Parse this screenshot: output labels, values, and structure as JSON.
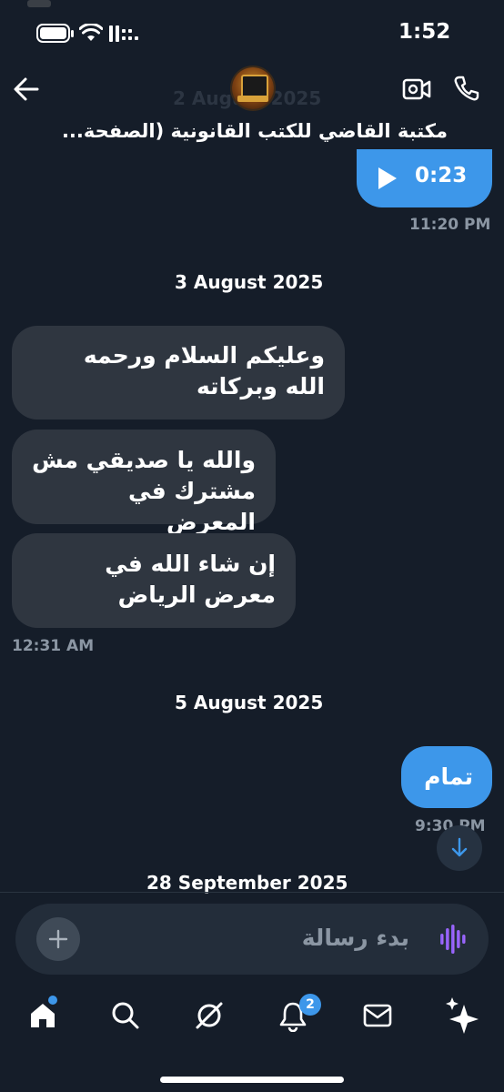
{
  "status_bar": {
    "time": "1:52"
  },
  "header": {
    "title": "مكتبة القاضي للكتب القانونية (الصفحة...",
    "faded_date": "2 August 2025"
  },
  "messages": {
    "voice": {
      "duration": "0:23",
      "time": "11:20 PM"
    },
    "date1": "3 August 2025",
    "m1": "وعليكم السلام ورحمه الله وبركاته",
    "m2": "والله يا صديقي مش مشترك في المعرض",
    "m3": "إن شاء الله في معرض الرياض",
    "group1_time": "12:31 AM",
    "date2": "5 August 2025",
    "m4": "تمام",
    "m4_time": "9:30 PM",
    "date3": "28 September 2025"
  },
  "composer": {
    "placeholder": "بدء رسالة"
  },
  "bottom_nav": {
    "notifications_badge": "2"
  },
  "colors": {
    "background": "#151d29",
    "accent": "#3d97ea",
    "incoming_bubble": "#2f3640"
  }
}
